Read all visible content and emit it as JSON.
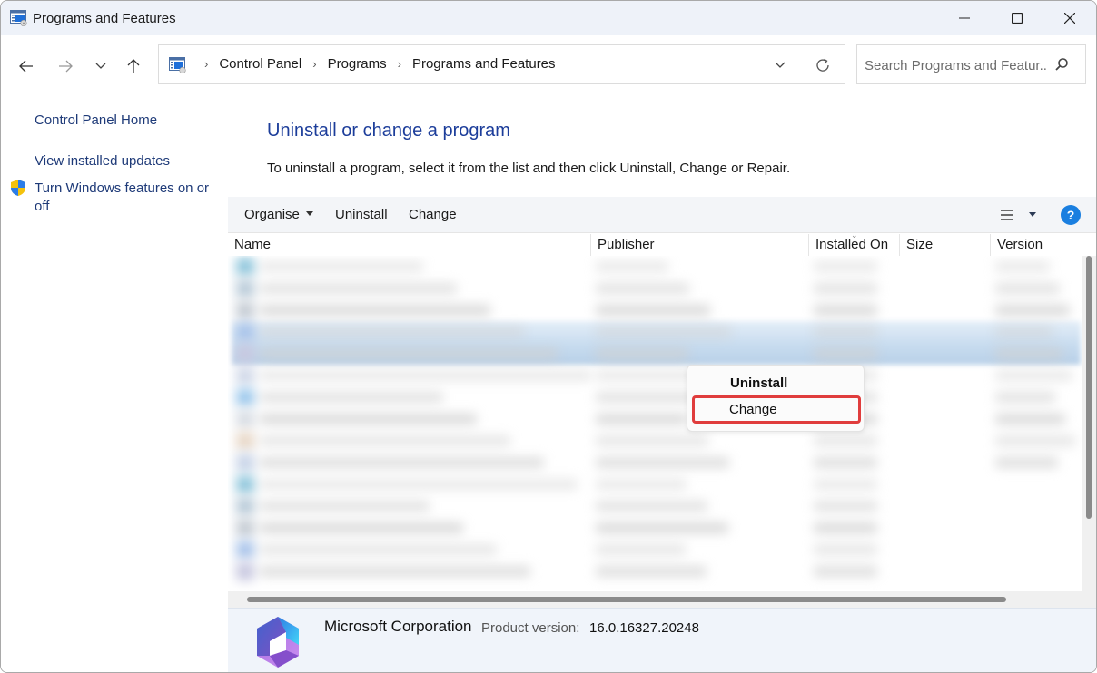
{
  "window": {
    "title": "Programs and Features",
    "controls": {
      "minimize": "minimize",
      "maximize": "maximize",
      "close": "close"
    }
  },
  "navigation": {
    "buttons": [
      "back",
      "forward",
      "recent-locations",
      "up"
    ],
    "breadcrumb": [
      "Control Panel",
      "Programs",
      "Programs and Features"
    ],
    "search": {
      "placeholder": "Search Programs and Featur...",
      "value": ""
    }
  },
  "sidebar": {
    "items": [
      {
        "label": "Control Panel Home"
      },
      {
        "label": "View installed updates"
      },
      {
        "label": "Turn Windows features on or off",
        "icon": "shield-icon"
      }
    ]
  },
  "main": {
    "title": "Uninstall or change a program",
    "description": "To uninstall a program, select it from the list and then click Uninstall, Change or Repair.",
    "toolbar": {
      "organise": "Organise",
      "uninstall": "Uninstall",
      "change": "Change",
      "help": "?"
    },
    "columns": [
      "Name",
      "Publisher",
      "Installed On",
      "Size",
      "Version"
    ],
    "list_note": "Program list rows are blurred in the screenshot"
  },
  "context_menu": {
    "items": [
      {
        "label": "Uninstall",
        "bold": true
      },
      {
        "label": "Change",
        "highlighted": true
      }
    ],
    "highlight_color": "#e03d3d"
  },
  "details": {
    "publisher": "Microsoft Corporation",
    "version_label": "Product version:",
    "version_value": "16.0.16327.20248"
  },
  "colors": {
    "title_bar": "#eef2f9",
    "link": "#1e3a78",
    "heading": "#1c3d9a",
    "help": "#1a7fe0",
    "details_bg": "#f0f4fa"
  }
}
